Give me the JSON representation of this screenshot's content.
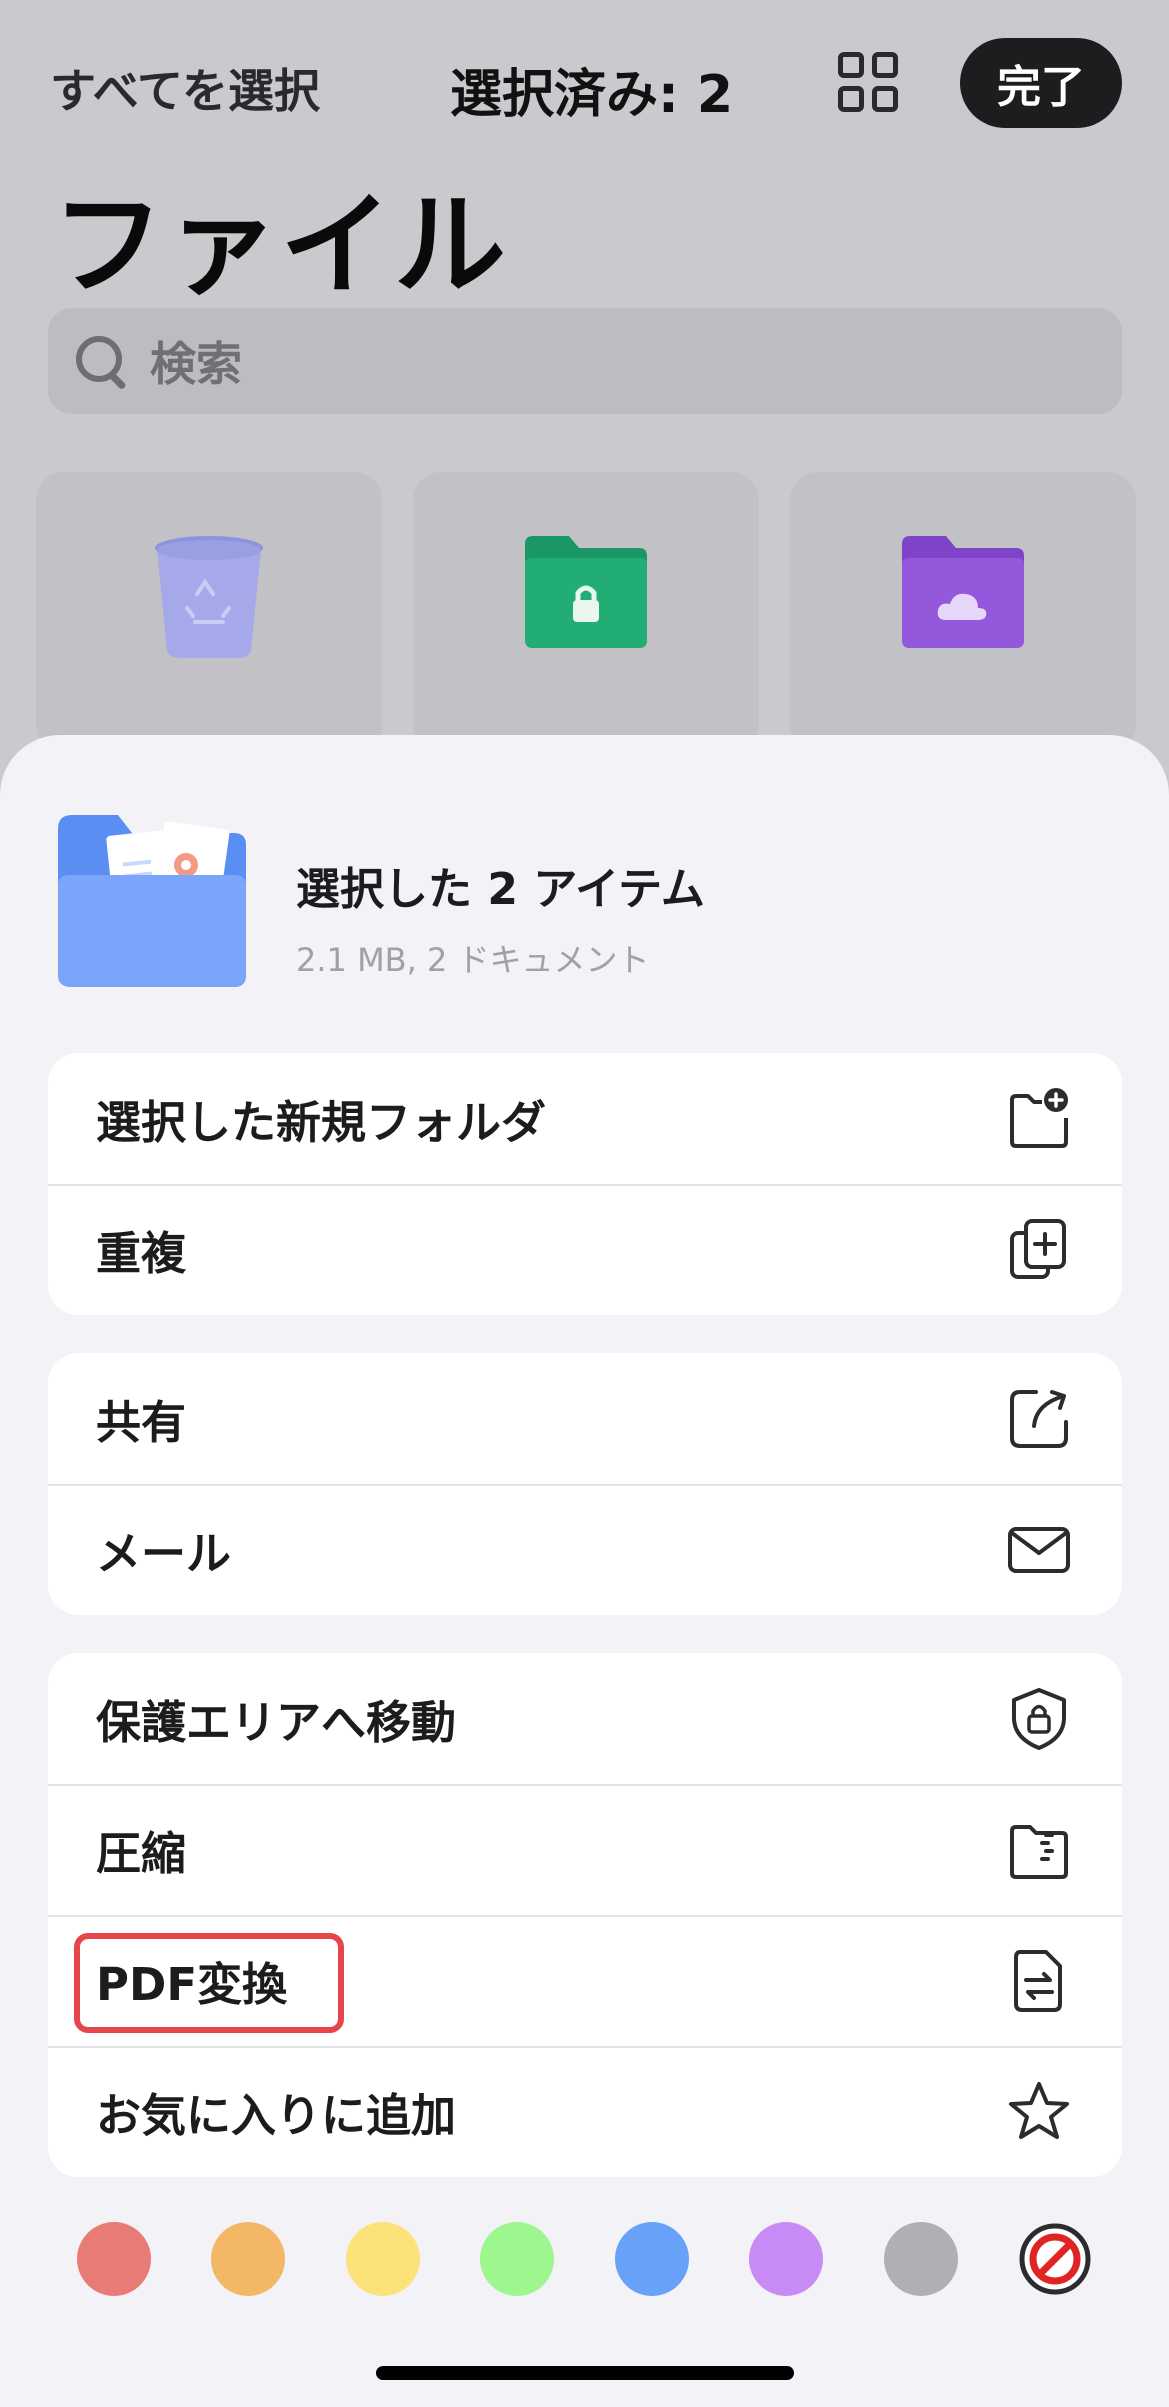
{
  "topbar": {
    "select_all": "すべてを選択",
    "selected_count": "選択済み: 2",
    "grid_icon": "grid-icon",
    "done": "完了"
  },
  "page_title": "ファイル",
  "search": {
    "placeholder": "検索"
  },
  "cards": [
    {
      "icon": "trash-icon",
      "color": "#a5a9e9"
    },
    {
      "icon": "secure-folder-icon",
      "color": "#1fa36c"
    },
    {
      "icon": "cloud-folder-icon",
      "color": "#8b4fd4"
    }
  ],
  "sheet": {
    "title": "選択した 2 アイテム",
    "subtitle": "2.1 MB, 2 ドキュメント",
    "groups": [
      [
        {
          "label": "選択した新規フォルダ",
          "icon": "new-folder-icon"
        },
        {
          "label": "重複",
          "icon": "duplicate-icon"
        }
      ],
      [
        {
          "label": "共有",
          "icon": "share-icon"
        },
        {
          "label": "メール",
          "icon": "mail-icon"
        }
      ],
      [
        {
          "label": "保護エリアへ移動",
          "icon": "shield-lock-icon"
        },
        {
          "label": "圧縮",
          "icon": "zip-icon"
        },
        {
          "label": "PDF変換",
          "icon": "convert-icon"
        },
        {
          "label": "お気に入りに追加",
          "icon": "star-icon"
        }
      ]
    ]
  },
  "tag_colors": [
    "#e97b77",
    "#f2b866",
    "#fbe379",
    "#9df68e",
    "#67a2f8",
    "#c88af4",
    "#b0afb4"
  ],
  "no_color_icon": "no-color-icon",
  "highlight_color": "#e6464a"
}
